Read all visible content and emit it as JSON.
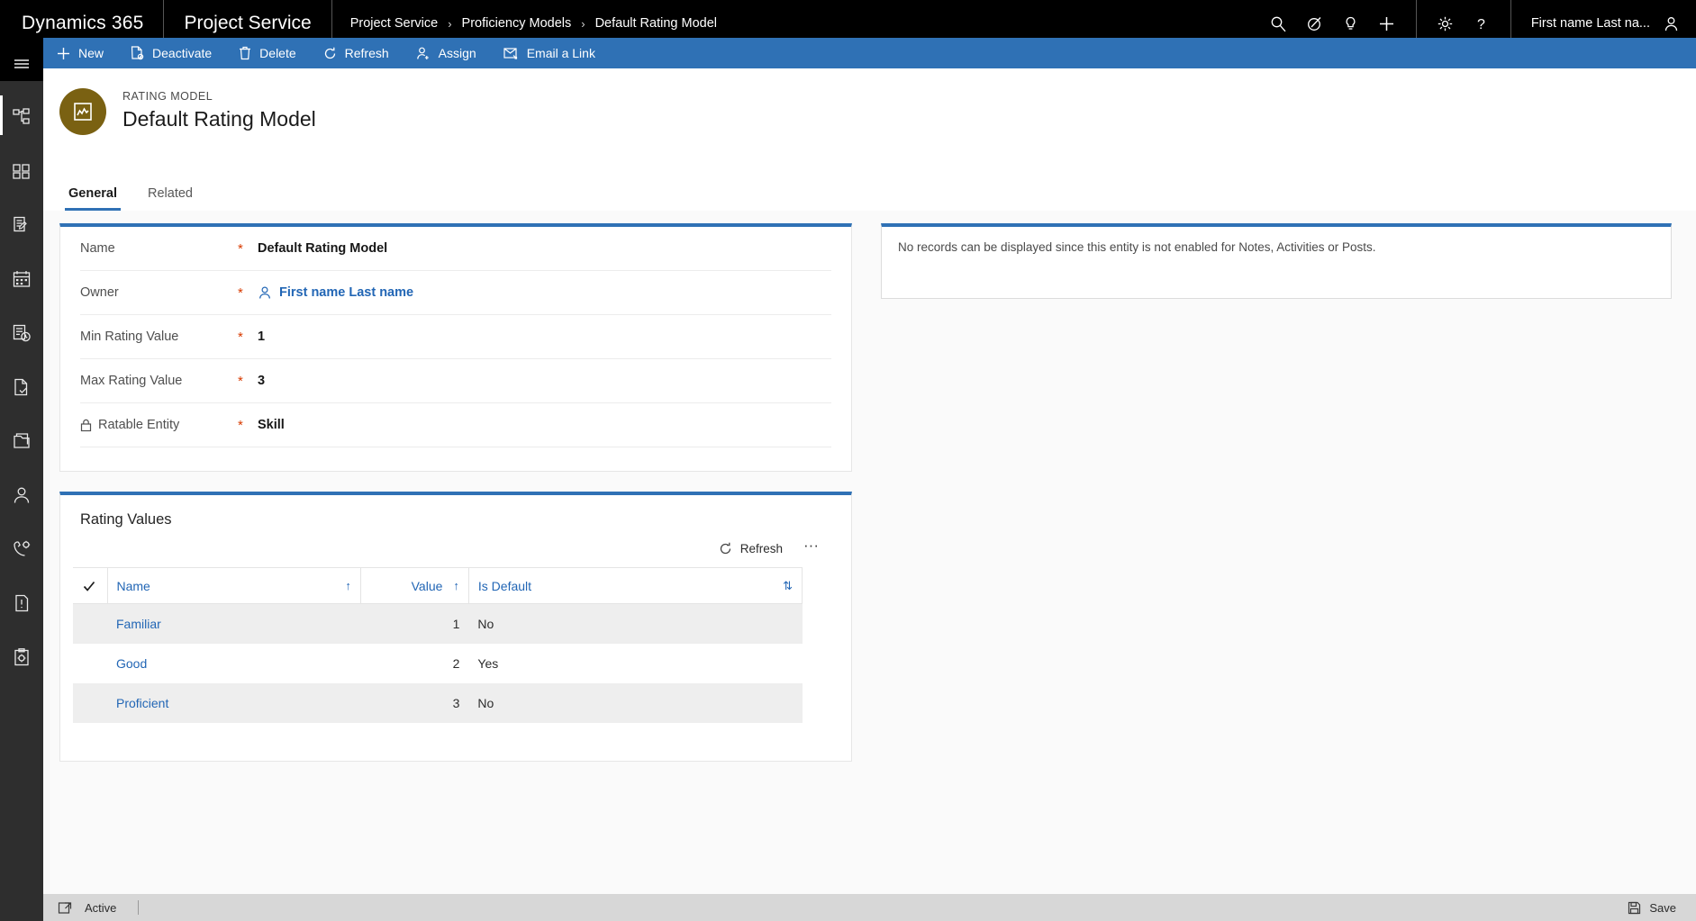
{
  "topnav": {
    "brand": "Dynamics 365",
    "app_name": "Project Service",
    "breadcrumb": [
      "Project Service",
      "Proficiency Models",
      "Default Rating Model"
    ],
    "separator": "›",
    "icons": [
      "search-icon",
      "assistant-icon",
      "lightbulb-icon",
      "plus-icon",
      "gear-icon",
      "help-icon"
    ],
    "user_name": "First name Last na..."
  },
  "sidebar": {
    "menu_icon": "hamburger-icon",
    "items": [
      {
        "icon": "sitemap-icon",
        "active": true
      },
      {
        "icon": "dashboard-chart-icon",
        "active": false
      },
      {
        "icon": "notes-edit-icon",
        "active": false
      },
      {
        "icon": "calendar-icon",
        "active": false
      },
      {
        "icon": "activity-history-icon",
        "active": false
      },
      {
        "icon": "document-check-icon",
        "active": false
      },
      {
        "icon": "copy-folder-icon",
        "active": false
      },
      {
        "icon": "person-icon",
        "active": false
      },
      {
        "icon": "phone-settings-icon",
        "active": false
      },
      {
        "icon": "alert-document-icon",
        "active": false
      },
      {
        "icon": "clipboard-settings-icon",
        "active": false
      }
    ]
  },
  "commandbar": {
    "buttons": [
      {
        "label": "New",
        "icon": "plus-icon"
      },
      {
        "label": "Deactivate",
        "icon": "deactivate-icon"
      },
      {
        "label": "Delete",
        "icon": "trash-icon"
      },
      {
        "label": "Refresh",
        "icon": "refresh-icon"
      },
      {
        "label": "Assign",
        "icon": "assign-person-icon"
      },
      {
        "label": "Email a Link",
        "icon": "email-link-icon"
      }
    ]
  },
  "record": {
    "kicker": "RATING MODEL",
    "title": "Default Rating Model",
    "avatar_icon": "rating-model-icon",
    "avatar_color": "#7a6112"
  },
  "tabs": [
    {
      "label": "General",
      "active": true
    },
    {
      "label": "Related",
      "active": false
    }
  ],
  "form": {
    "fields": [
      {
        "label": "Name",
        "required": "*",
        "value": "Default Rating Model",
        "type": "text",
        "locked": false
      },
      {
        "label": "Owner",
        "required": "*",
        "value": "First name Last name",
        "type": "lookup",
        "locked": false
      },
      {
        "label": "Min Rating Value",
        "required": "*",
        "value": "1",
        "type": "text",
        "locked": false
      },
      {
        "label": "Max Rating Value",
        "required": "*",
        "value": "3",
        "type": "text",
        "locked": false
      },
      {
        "label": "Ratable Entity",
        "required": "*",
        "value": "Skill",
        "type": "text",
        "locked": true
      }
    ]
  },
  "notes_panel": {
    "message": "No records can be displayed since this entity is not enabled for Notes, Activities or Posts."
  },
  "subgrid": {
    "title": "Rating Values",
    "toolbar": {
      "refresh_label": "Refresh",
      "refresh_icon": "refresh-icon",
      "more_label": "···"
    },
    "columns": [
      {
        "label": "Name",
        "sort": "↑"
      },
      {
        "label": "Value",
        "sort": "↑"
      },
      {
        "label": "Is Default",
        "sort": "⇅"
      }
    ],
    "rows": [
      {
        "name": "Familiar",
        "value": "1",
        "is_default": "No"
      },
      {
        "name": "Good",
        "value": "2",
        "is_default": "Yes"
      },
      {
        "name": "Proficient",
        "value": "3",
        "is_default": "No"
      }
    ]
  },
  "footer": {
    "status_icon": "open-record-icon",
    "status": "Active",
    "save_label": "Save",
    "save_icon": "save-disk-icon"
  },
  "colors": {
    "accent_blue": "#2f71b5",
    "link_blue": "#2266b5",
    "topbar_black": "#000000",
    "rail_gray": "#2e2e2e",
    "required_red": "#d83b01",
    "row_alt": "#eeeeee"
  }
}
